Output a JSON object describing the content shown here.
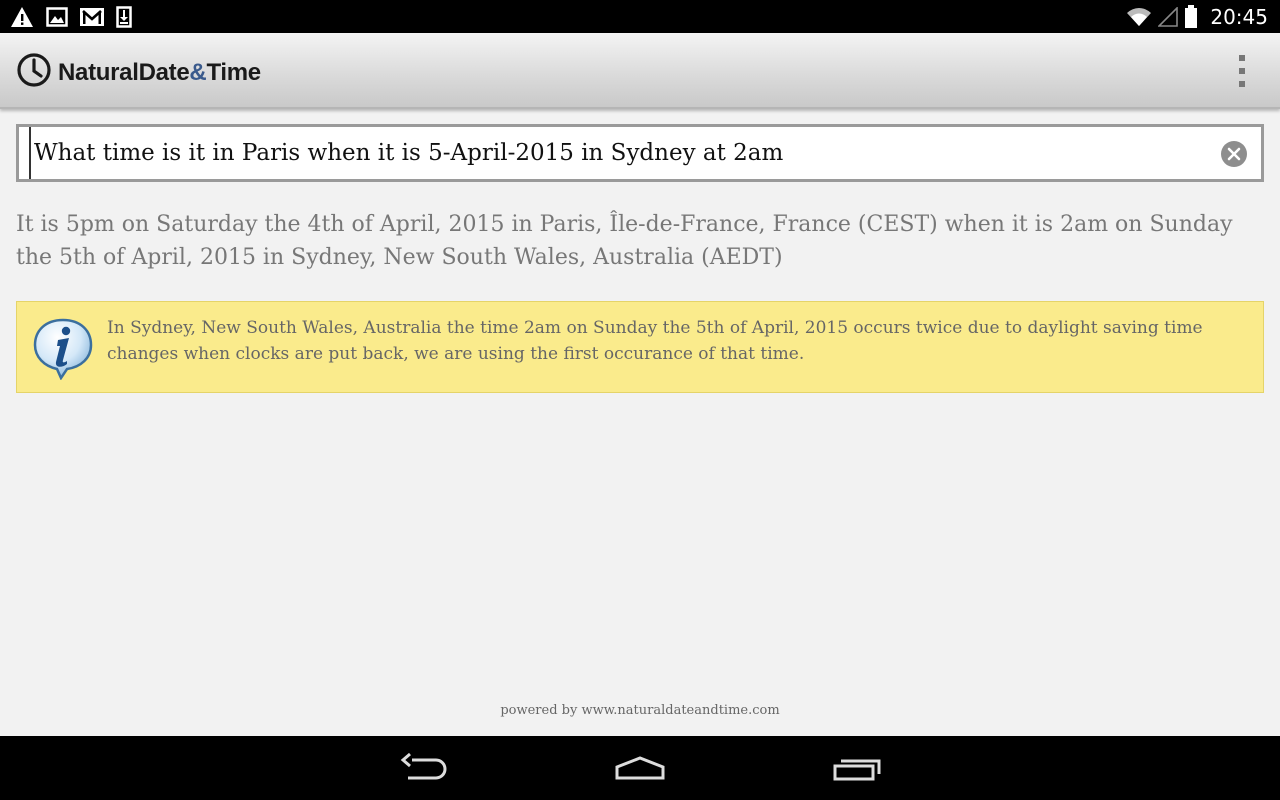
{
  "status_bar": {
    "left_icons": [
      "warning-icon",
      "image-icon",
      "gmail-icon",
      "download-icon"
    ],
    "right_icons": [
      "wifi-icon",
      "signal-icon",
      "battery-icon"
    ],
    "time": "20:45"
  },
  "action_bar": {
    "logo_icon": "clock-icon",
    "app_name_part1": "NaturalDate",
    "app_name_amp": "&",
    "app_name_part2": "Time",
    "menu_icon": "overflow-menu-icon"
  },
  "search": {
    "value": "What time is it in Paris when it is 5-April-2015 in Sydney at 2am",
    "clear_icon": "clear-icon"
  },
  "answer": {
    "text": "It is 5pm on Saturday the 4th of April, 2015 in Paris, Île-de-France, France (CEST) when it is 2am on Sunday the 5th of April, 2015 in Sydney, New South Wales, Australia (AEDT)"
  },
  "info": {
    "icon": "info-icon",
    "text": "In Sydney, New South Wales, Australia the time 2am on Sunday the 5th of April, 2015 occurs twice due to daylight saving time changes when clocks are put back, we are using the first occurance of that time."
  },
  "footer": {
    "powered_by": "powered by www.naturaldateandtime.com"
  },
  "nav_bar": {
    "buttons": [
      "back-icon",
      "home-icon",
      "recent-apps-icon"
    ]
  },
  "colors": {
    "info_background": "#faeb8c",
    "logo_amp": "#3a5a8c"
  }
}
